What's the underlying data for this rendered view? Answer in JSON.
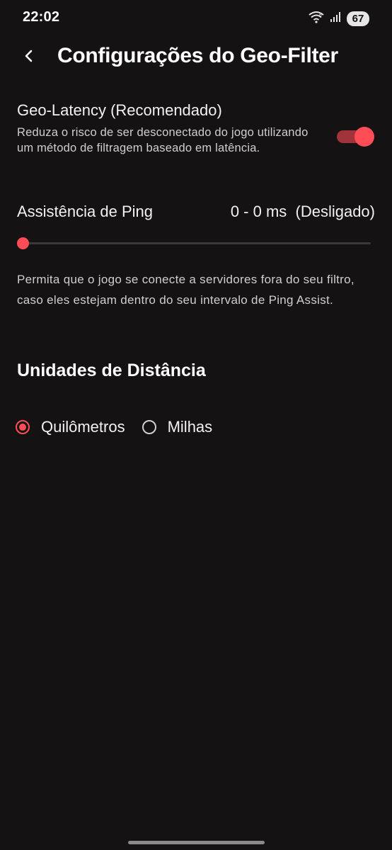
{
  "status_bar": {
    "time": "22:02",
    "battery": "67",
    "icons": [
      "wifi-icon",
      "signal-icon",
      "battery-icon"
    ]
  },
  "header": {
    "back_icon": "chevron-left-icon",
    "title": "Configurações do Geo-Filter"
  },
  "geo_latency": {
    "title": "Geo-Latency (Recomendado)",
    "description": "Reduza o risco de ser desconectado do jogo utilizando um método de filtragem baseado em latência.",
    "enabled": true
  },
  "ping_assist": {
    "label": "Assistência de Ping",
    "value": "0 - 0 ms  (Desligado)",
    "slider_fraction": 0,
    "description": "Permita que o jogo se conecte a servidores fora do seu filtro, caso eles estejam dentro do seu intervalo de Ping Assist."
  },
  "distance_units": {
    "title": "Unidades de Distância",
    "options": [
      {
        "label": "Quilômetros",
        "selected": true
      },
      {
        "label": "Milhas",
        "selected": false
      }
    ]
  },
  "colors": {
    "accent": "#ff4d57",
    "toggle_track": "#a1333a",
    "background": "#141212"
  }
}
